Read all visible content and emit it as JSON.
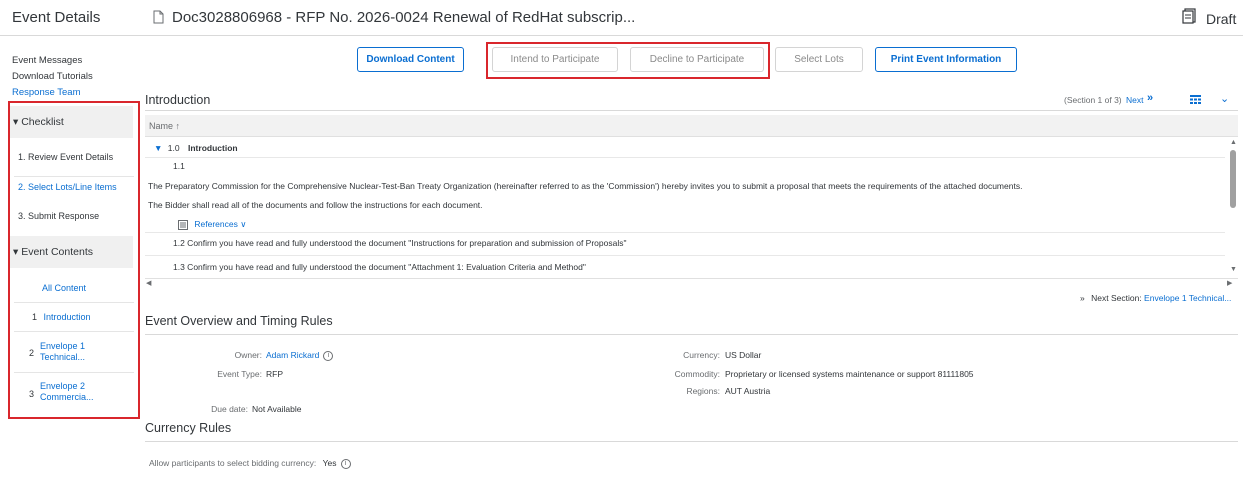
{
  "header": {
    "app_title": "Event Details",
    "doc_title": "Doc3028806968 - RFP No. 2026-0024 Renewal of RedHat subscrip...",
    "status": "Draft"
  },
  "sidebar": {
    "links": [
      "Event Messages",
      "Download Tutorials",
      "Response Team"
    ],
    "checklist_title": "Checklist",
    "checklist": [
      {
        "num": "1.",
        "label": "Review Event Details"
      },
      {
        "num": "2.",
        "label": "Select Lots/Line Items"
      },
      {
        "num": "3.",
        "label": "Submit Response"
      }
    ],
    "contents_title": "Event Contents",
    "contents": [
      {
        "num": "",
        "label": "All Content"
      },
      {
        "num": "1",
        "label": "Introduction"
      },
      {
        "num": "2",
        "label_1": "Envelope 1",
        "label_2": "Technical..."
      },
      {
        "num": "3",
        "label_1": "Envelope 2",
        "label_2": "Commercia..."
      }
    ]
  },
  "toolbar": {
    "download": "Download Content",
    "intend": "Intend to Participate",
    "decline": "Decline to Participate",
    "select_lots": "Select Lots",
    "print": "Print Event Information"
  },
  "introduction": {
    "title": "Introduction",
    "section_info": "(Section 1 of 3)",
    "next": "Next",
    "column": "Name ↑",
    "group_num": "1.0",
    "group_label": "Introduction",
    "item_num": "1.1",
    "para_1": "The Preparatory Commission for the Comprehensive Nuclear-Test-Ban Treaty Organization (hereinafter referred to as the 'Commission') hereby invites you to submit a proposal that meets the requirements of the attached documents.",
    "para_2": "The Bidder shall read all of the documents and follow the instructions for each document.",
    "references": "References",
    "item_2": "1.2  Confirm you have read and fully understood the document \"Instructions for preparation and submission of Proposals\"",
    "item_3": "1.3  Confirm you have read and fully understood the document \"Attachment 1: Evaluation Criteria and Method\"",
    "next_section_label": "Next Section:",
    "next_section_link": "Envelope 1 Technical..."
  },
  "overview": {
    "title": "Event Overview and Timing Rules",
    "owner_label": "Owner:",
    "owner": "Adam Rickard",
    "event_type_label": "Event Type:",
    "event_type": "RFP",
    "due_label": "Due date:",
    "due": "Not Available",
    "currency_label": "Currency:",
    "currency": "US Dollar",
    "commodity_label": "Commodity:",
    "commodity": "Proprietary or licensed systems maintenance or support 81111805",
    "regions_label": "Regions:",
    "regions": "AUT Austria"
  },
  "currency_rules": {
    "title": "Currency Rules",
    "allow_label": "Allow participants to select bidding currency:",
    "allow_value": "Yes"
  },
  "colors": {
    "accent": "#0a6ed1",
    "highlight": "#d9262c"
  }
}
